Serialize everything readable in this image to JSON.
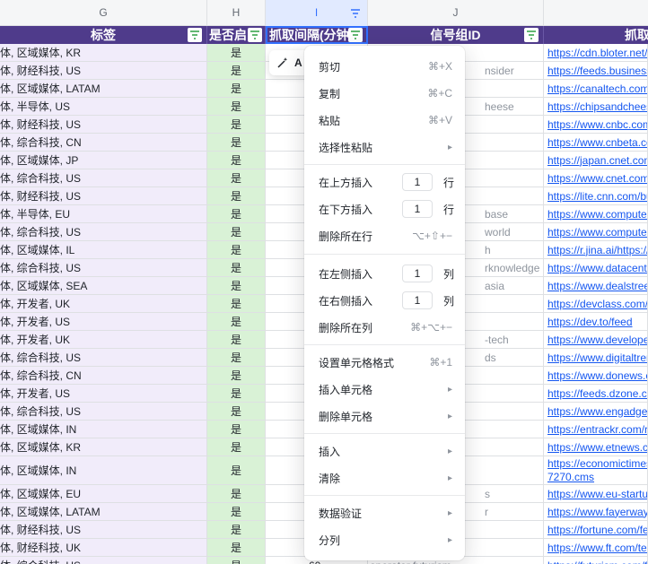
{
  "columns": [
    {
      "letter": "G"
    },
    {
      "letter": "H"
    },
    {
      "letter": "I"
    },
    {
      "letter": "J"
    }
  ],
  "headers": {
    "g": "标签",
    "h": "是否启",
    "i": "抓取间隔(分钟",
    "j": "信号组ID",
    "k": "抓取"
  },
  "ai_chip": {
    "label": "A"
  },
  "rows": [
    {
      "tags": "媒体, 区域媒体, KR",
      "enabled": "是",
      "group": "",
      "url": "https://cdn.bloter.net/rss"
    },
    {
      "tags": "媒体, 财经科技, US",
      "enabled": "是",
      "group": "nsider",
      "url": "https://feeds.businessins"
    },
    {
      "tags": "媒体, 区域媒体, LATAM",
      "enabled": "是",
      "group": "",
      "url": "https://canaltech.com.br/"
    },
    {
      "tags": "媒体, 半导体, US",
      "enabled": "是",
      "group": "heese",
      "url": "https://chipsandcheese.c"
    },
    {
      "tags": "媒体, 财经科技, US",
      "enabled": "是",
      "group": "",
      "url": "https://www.cnbc.com/id"
    },
    {
      "tags": "媒体, 综合科技, CN",
      "enabled": "是",
      "group": "",
      "url": "https://www.cnbeta.com"
    },
    {
      "tags": "媒体, 区域媒体, JP",
      "enabled": "是",
      "group": "",
      "url": "https://japan.cnet.com/r"
    },
    {
      "tags": "媒体, 综合科技, US",
      "enabled": "是",
      "group": "",
      "url": "https://www.cnet.com/rss"
    },
    {
      "tags": "媒体, 财经科技, US",
      "enabled": "是",
      "group": "",
      "url": "https://lite.cnn.com/busi"
    },
    {
      "tags": "媒体, 半导体, EU",
      "enabled": "是",
      "group": "base",
      "url": "https://www.computerbas"
    },
    {
      "tags": "媒体, 综合科技, US",
      "enabled": "是",
      "group": "world",
      "url": "https://www.computerwor"
    },
    {
      "tags": "媒体, 区域媒体, IL",
      "enabled": "是",
      "group": "h",
      "url": "https://r.jina.ai/https://w"
    },
    {
      "tags": "媒体, 综合科技, US",
      "enabled": "是",
      "group": "rknowledge",
      "url": "https://www.datacenterkn"
    },
    {
      "tags": "媒体, 区域媒体, SEA",
      "enabled": "是",
      "group": "asia",
      "url": "https://www.dealstreetas"
    },
    {
      "tags": "媒体, 开发者, UK",
      "enabled": "是",
      "group": "",
      "url": "https://devclass.com/fee"
    },
    {
      "tags": "媒体, 开发者, US",
      "enabled": "是",
      "group": "",
      "url": "https://dev.to/feed"
    },
    {
      "tags": "媒体, 开发者, UK",
      "enabled": "是",
      "group": "-tech",
      "url": "https://www.developer-te"
    },
    {
      "tags": "媒体, 综合科技, US",
      "enabled": "是",
      "group": "ds",
      "url": "https://www.digitaltrends"
    },
    {
      "tags": "媒体, 综合科技, CN",
      "enabled": "是",
      "group": "",
      "url": "https://www.donews.com"
    },
    {
      "tags": "媒体, 开发者, US",
      "enabled": "是",
      "group": "",
      "url": "https://feeds.dzone.com"
    },
    {
      "tags": "媒体, 综合科技, US",
      "enabled": "是",
      "group": "",
      "url": "https://www.engadget.co"
    },
    {
      "tags": "媒体, 区域媒体, IN",
      "enabled": "是",
      "group": "",
      "url": "https://entrackr.com/rss"
    },
    {
      "tags": "媒体, 区域媒体, KR",
      "enabled": "是",
      "group": "",
      "url": "https://www.etnews.com/"
    },
    {
      "tags": "媒体, 区域媒体, IN",
      "enabled": "是",
      "group": "",
      "url": "https://economictimes.in",
      "url2": "7270.cms"
    },
    {
      "tags": "媒体, 区域媒体, EU",
      "enabled": "是",
      "group": "s",
      "url": "https://www.eu-startups."
    },
    {
      "tags": "媒体, 区域媒体, LATAM",
      "enabled": "是",
      "group": "r",
      "url": "https://www.fayerwayer.c"
    },
    {
      "tags": "媒体, 财经科技, US",
      "enabled": "是",
      "group": "",
      "url": "https://fortune.com/feed"
    },
    {
      "tags": "媒体, 财经科技, UK",
      "enabled": "是",
      "group": "",
      "url": "https://www.ft.com/techn"
    },
    {
      "tags": "媒体, 综合科技, US",
      "enabled": "是",
      "group": "operator futurism",
      "url": "https://futurism.com/feed",
      "interval": "60"
    }
  ],
  "menu": {
    "cut": {
      "label": "剪切",
      "shortcut": "⌘+X"
    },
    "copy": {
      "label": "复制",
      "shortcut": "⌘+C"
    },
    "paste": {
      "label": "粘贴",
      "shortcut": "⌘+V"
    },
    "paste_special": {
      "label": "选择性粘贴"
    },
    "insert_above": {
      "label": "在上方插入",
      "count": "1",
      "unit": "行"
    },
    "insert_below": {
      "label": "在下方插入",
      "count": "1",
      "unit": "行"
    },
    "delete_row": {
      "label": "删除所在行",
      "shortcut": "⌥+⇧+−"
    },
    "insert_left": {
      "label": "在左侧插入",
      "count": "1",
      "unit": "列"
    },
    "insert_right": {
      "label": "在右侧插入",
      "count": "1",
      "unit": "列"
    },
    "delete_col": {
      "label": "删除所在列",
      "shortcut": "⌘+⌥+−"
    },
    "format_cells": {
      "label": "设置单元格格式",
      "shortcut": "⌘+1"
    },
    "insert_cells": {
      "label": "插入单元格"
    },
    "delete_cells": {
      "label": "删除单元格"
    },
    "insert": {
      "label": "插入"
    },
    "clear": {
      "label": "清除"
    },
    "data_validation": {
      "label": "数据验证"
    },
    "split_col": {
      "label": "分列"
    }
  },
  "colors": {
    "header_bg": "#4f3b8b",
    "tag_bg": "#f1ecfa",
    "enabled_bg": "#d9f2d6",
    "link": "#1456f0",
    "selection": "#3370ff"
  }
}
